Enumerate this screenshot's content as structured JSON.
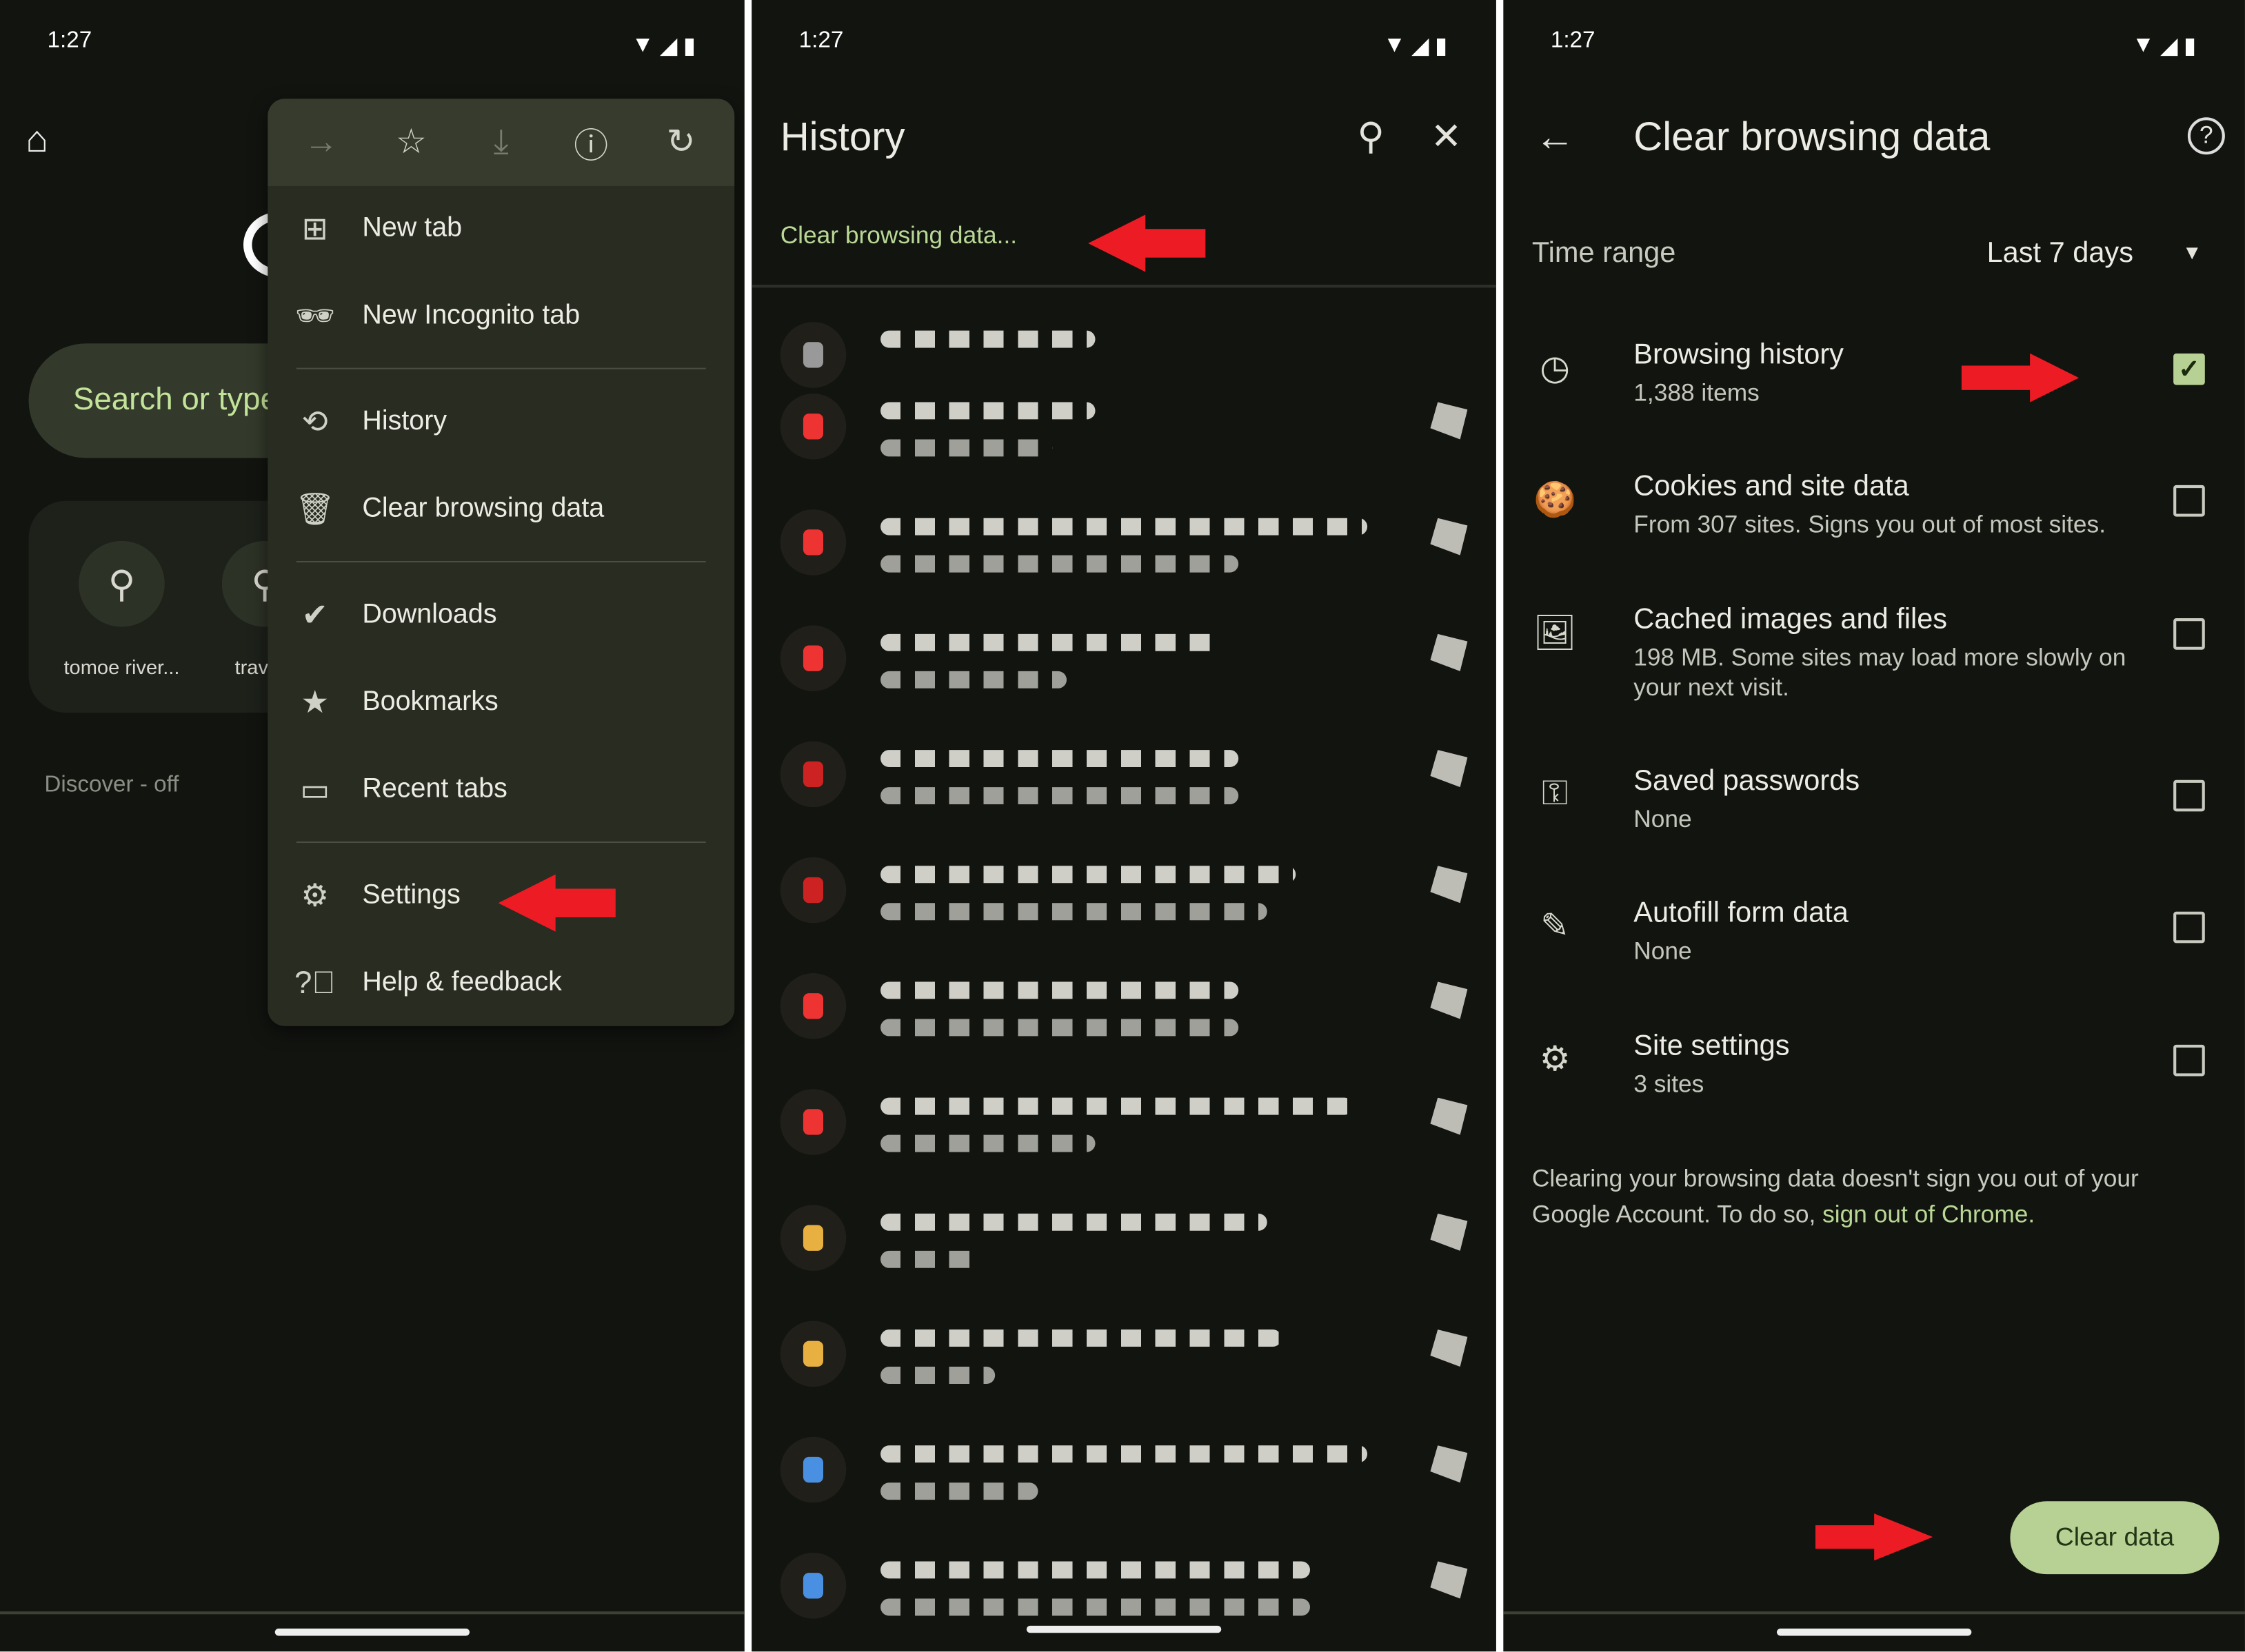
{
  "status_bar": {
    "time": "1:27"
  },
  "panel1": {
    "search_placeholder": "Search or type",
    "shortcuts": [
      {
        "label": "tomoe river...",
        "icon": "search-icon"
      },
      {
        "label": "travele",
        "icon": "search-icon"
      }
    ],
    "discover": "Discover - off",
    "menu": {
      "toolbar": [
        "forward-icon",
        "star-icon",
        "download-icon",
        "info-icon",
        "refresh-icon"
      ],
      "items": [
        {
          "label": "New tab",
          "icon": "new-tab-icon"
        },
        {
          "label": "New Incognito tab",
          "icon": "incognito-icon"
        },
        {
          "label": "History",
          "icon": "history-icon"
        },
        {
          "label": "Clear browsing data",
          "icon": "trash-icon"
        },
        {
          "label": "Downloads",
          "icon": "downloads-icon"
        },
        {
          "label": "Bookmarks",
          "icon": "star-icon"
        },
        {
          "label": "Recent tabs",
          "icon": "devices-icon"
        },
        {
          "label": "Settings",
          "icon": "gear-icon"
        },
        {
          "label": "Help & feedback",
          "icon": "help-icon"
        }
      ]
    }
  },
  "panel2": {
    "title": "History",
    "clear_link": "Clear browsing data...",
    "favicon_colors": [
      "#999",
      "#e33",
      "#e33",
      "#e33",
      "#c22",
      "#c22",
      "#e33",
      "#e33",
      "#e8b040",
      "#e8b040",
      "#4a90e2",
      "#4a90e2"
    ]
  },
  "panel3": {
    "title": "Clear browsing data",
    "time_range_label": "Time range",
    "time_range_value": "Last 7 days",
    "options": [
      {
        "title": "Browsing history",
        "subtitle": "1,388 items",
        "checked": true,
        "icon": "clock-icon"
      },
      {
        "title": "Cookies and site data",
        "subtitle": "From 307 sites. Signs you out of most sites.",
        "checked": false,
        "icon": "cookie-icon"
      },
      {
        "title": "Cached images and files",
        "subtitle": "198 MB. Some sites may load more slowly on your next visit.",
        "checked": false,
        "icon": "image-icon"
      },
      {
        "title": "Saved passwords",
        "subtitle": "None",
        "checked": false,
        "icon": "key-icon"
      },
      {
        "title": "Autofill form data",
        "subtitle": "None",
        "checked": false,
        "icon": "pencil-icon"
      },
      {
        "title": "Site settings",
        "subtitle": "3 sites",
        "checked": false,
        "icon": "site-settings-icon"
      }
    ],
    "note_text": "Clearing your browsing data doesn't sign you out of your Google Account. To do so, ",
    "note_link": "sign out of Chrome.",
    "clear_button": "Clear data"
  },
  "colors": {
    "background": "#121410",
    "accent": "#b7d094",
    "annotation_arrow": "#ed1c24"
  }
}
